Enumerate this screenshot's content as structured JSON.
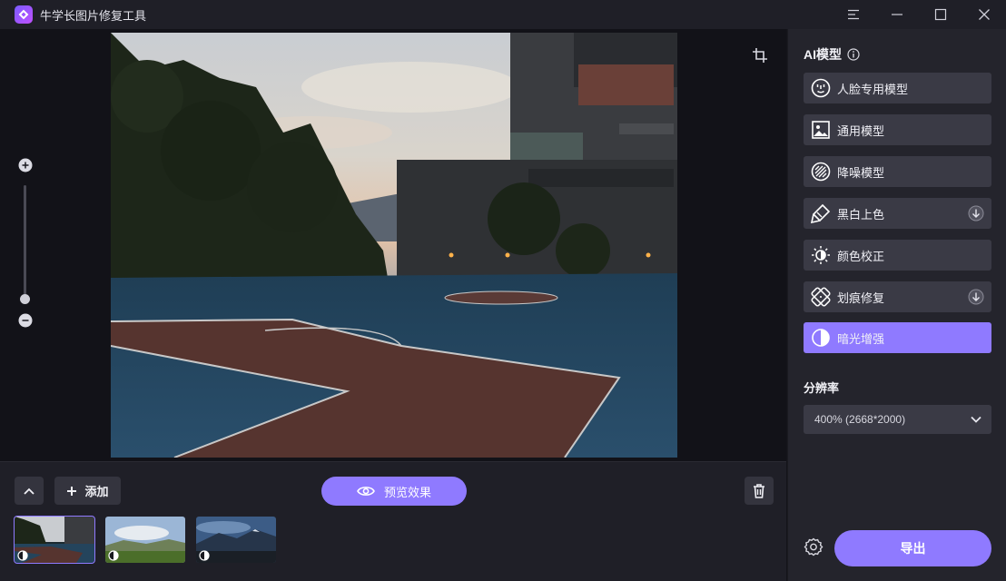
{
  "app": {
    "title": "牛学长图片修复工具"
  },
  "window_controls": {
    "menu_icon": "menu-icon",
    "minimize_icon": "minimize-icon",
    "maximize_icon": "maximize-icon",
    "close_icon": "close-icon"
  },
  "toolbar": {
    "add_label": "添加",
    "preview_label": "预览效果"
  },
  "panel": {
    "ai_title": "AI模型",
    "models": [
      {
        "label": "人脸专用模型",
        "icon": "face-icon",
        "download": false,
        "active": false
      },
      {
        "label": "通用模型",
        "icon": "image-icon",
        "download": false,
        "active": false
      },
      {
        "label": "降噪模型",
        "icon": "denoise-icon",
        "download": false,
        "active": false
      },
      {
        "label": "黑白上色",
        "icon": "colorize-brush-icon",
        "download": true,
        "active": false
      },
      {
        "label": "颜色校正",
        "icon": "sun-icon",
        "download": false,
        "active": false
      },
      {
        "label": "划痕修复",
        "icon": "scratch-repair-icon",
        "download": true,
        "active": false
      },
      {
        "label": "暗光增强",
        "icon": "contrast-icon",
        "download": false,
        "active": true
      }
    ],
    "resolution_title": "分辨率",
    "resolution_value": "400% (2668*2000)",
    "export_label": "导出"
  },
  "thumbnails": [
    {
      "name": "basketball-court",
      "active": true
    },
    {
      "name": "green-valley",
      "active": false
    },
    {
      "name": "mountain-dusk",
      "active": false
    }
  ],
  "colors": {
    "accent": "#8f7aff",
    "panel": "#24242c",
    "button": "#3a3a45",
    "background": "#14141a"
  }
}
